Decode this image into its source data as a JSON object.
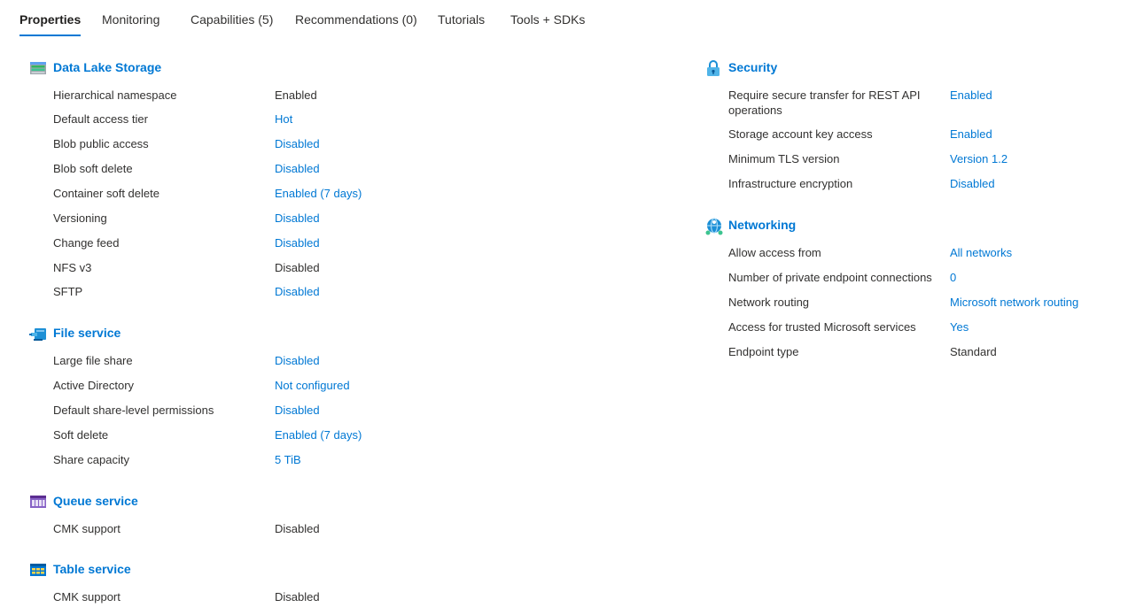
{
  "tabs": [
    {
      "label": "Properties",
      "active": true
    },
    {
      "label": "Monitoring",
      "active": false
    },
    {
      "label": "Capabilities (5)",
      "active": false
    },
    {
      "label": "Recommendations (0)",
      "active": false
    },
    {
      "label": "Tutorials",
      "active": false
    },
    {
      "label": "Tools + SDKs",
      "active": false
    }
  ],
  "colors": {
    "accent": "#0078d4",
    "text": "#323130"
  },
  "left": {
    "data_lake": {
      "title": "Data Lake Storage",
      "icon": "data-lake-storage-icon",
      "rows": [
        {
          "label": "Hierarchical namespace",
          "value": "Enabled",
          "link": false
        },
        {
          "label": "Default access tier",
          "value": "Hot",
          "link": true
        },
        {
          "label": "Blob public access",
          "value": "Disabled",
          "link": true
        },
        {
          "label": "Blob soft delete",
          "value": "Disabled",
          "link": true
        },
        {
          "label": "Container soft delete",
          "value": "Enabled (7 days)",
          "link": true
        },
        {
          "label": "Versioning",
          "value": "Disabled",
          "link": true
        },
        {
          "label": "Change feed",
          "value": "Disabled",
          "link": true
        },
        {
          "label": "NFS v3",
          "value": "Disabled",
          "link": false
        },
        {
          "label": "SFTP",
          "value": "Disabled",
          "link": true
        }
      ]
    },
    "file_service": {
      "title": "File service",
      "icon": "file-service-icon",
      "rows": [
        {
          "label": "Large file share",
          "value": "Disabled",
          "link": true
        },
        {
          "label": "Active Directory",
          "value": "Not configured",
          "link": true
        },
        {
          "label": "Default share-level permissions",
          "value": "Disabled",
          "link": true
        },
        {
          "label": "Soft delete",
          "value": "Enabled (7 days)",
          "link": true
        },
        {
          "label": "Share capacity",
          "value": "5 TiB",
          "link": true
        }
      ]
    },
    "queue_service": {
      "title": "Queue service",
      "icon": "queue-service-icon",
      "rows": [
        {
          "label": "CMK support",
          "value": "Disabled",
          "link": false
        }
      ]
    },
    "table_service": {
      "title": "Table service",
      "icon": "table-service-icon",
      "rows": [
        {
          "label": "CMK support",
          "value": "Disabled",
          "link": false
        }
      ]
    }
  },
  "right": {
    "security": {
      "title": "Security",
      "icon": "security-lock-icon",
      "rows": [
        {
          "label": "Require secure transfer for REST API",
          "label2": "operations",
          "value": "Enabled",
          "link": true
        },
        {
          "label": "Storage account key access",
          "value": "Enabled",
          "link": true
        },
        {
          "label": "Minimum TLS version",
          "value": "Version 1.2",
          "link": true
        },
        {
          "label": "Infrastructure encryption",
          "value": "Disabled",
          "link": true
        }
      ]
    },
    "networking": {
      "title": "Networking",
      "icon": "networking-icon",
      "rows": [
        {
          "label": "Allow access from",
          "value": "All networks",
          "link": true
        },
        {
          "label": "Number of private endpoint connections",
          "value": "0",
          "link": true
        },
        {
          "label": "Network routing",
          "value": "Microsoft network routing",
          "link": true
        },
        {
          "label": "Access for trusted Microsoft services",
          "value": "Yes",
          "link": true
        },
        {
          "label": "Endpoint type",
          "value": "Standard",
          "link": false
        }
      ]
    }
  }
}
